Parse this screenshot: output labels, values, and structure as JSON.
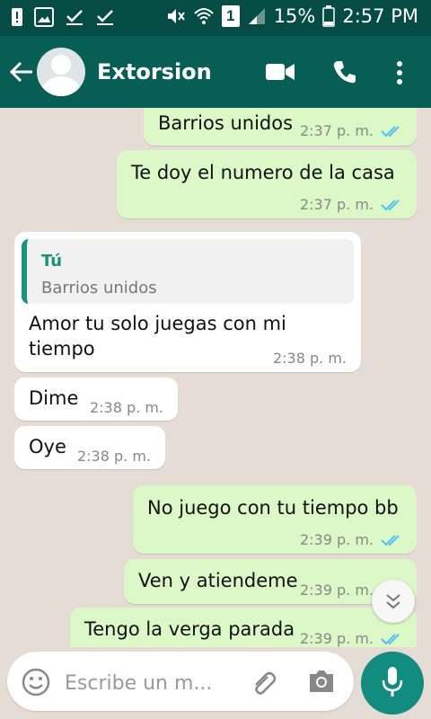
{
  "status_bar": {
    "battery_pct": "15%",
    "time": "2:57 PM",
    "sim": "1"
  },
  "header": {
    "title": "Extorsion"
  },
  "messages": [
    {
      "dir": "out",
      "text": "Barrios unidos",
      "time": "2:37 p. m."
    },
    {
      "dir": "out",
      "text": "Te doy el numero de la casa",
      "time": "2:37 p. m."
    },
    {
      "dir": "in",
      "quote_author": "Tú",
      "quote_text": "Barrios unidos",
      "text_line1": "Amor tu solo juegas con mi",
      "text_line2": "tiempo",
      "time": "2:38 p. m."
    },
    {
      "dir": "in",
      "text": "Dime",
      "time": "2:38 p. m."
    },
    {
      "dir": "in",
      "text": "Oye",
      "time": "2:38 p. m."
    },
    {
      "dir": "out",
      "text": "No juego con tu tiempo bb",
      "time": "2:39 p. m."
    },
    {
      "dir": "out",
      "text": "Ven y atiendeme",
      "time": "2:39 p. m."
    },
    {
      "dir": "out",
      "text": "Tengo la verga parada",
      "time": "2:39 p. m."
    }
  ],
  "input": {
    "placeholder": "Escribe un m..."
  },
  "colors": {
    "header": "#075e54",
    "status_bar": "#054d44",
    "outgoing": "#dcf8c6",
    "incoming": "#ffffff",
    "read_tick": "#4fc3f7",
    "accent": "#128c7e"
  },
  "icons": [
    "back-arrow-icon",
    "avatar",
    "video-call-icon",
    "phone-icon",
    "more-vert-icon",
    "emoji-icon",
    "attach-icon",
    "camera-icon",
    "mic-icon",
    "scroll-down-icon"
  ]
}
